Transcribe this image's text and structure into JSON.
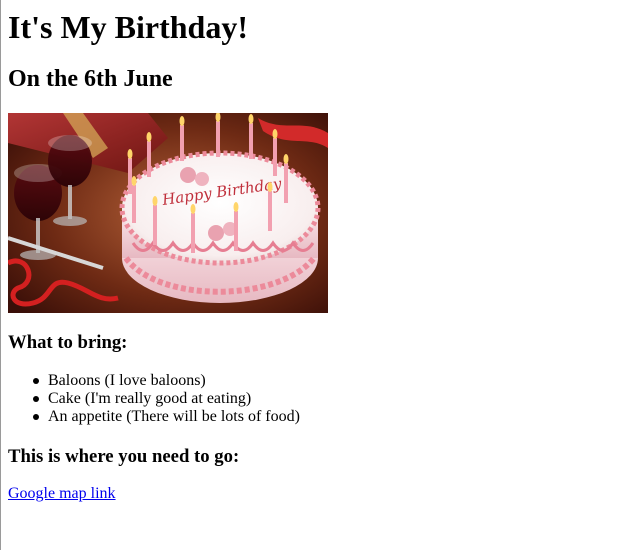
{
  "page": {
    "title": "It's My Birthday!",
    "subtitle": "On the 6th June",
    "bring_heading": "What to bring:",
    "bring_items": [
      "Baloons (I love baloons)",
      "Cake (I'm really good at eating)",
      "An appetite (There will be lots of food)"
    ],
    "location_heading": "This is where you need to go:",
    "map_link_label": "Google map link"
  },
  "image": {
    "icon": "birthday-cake-photo",
    "cake_text": "Happy Birthday"
  },
  "colors": {
    "link": "#0000ee",
    "text": "#000000",
    "background": "#ffffff"
  }
}
